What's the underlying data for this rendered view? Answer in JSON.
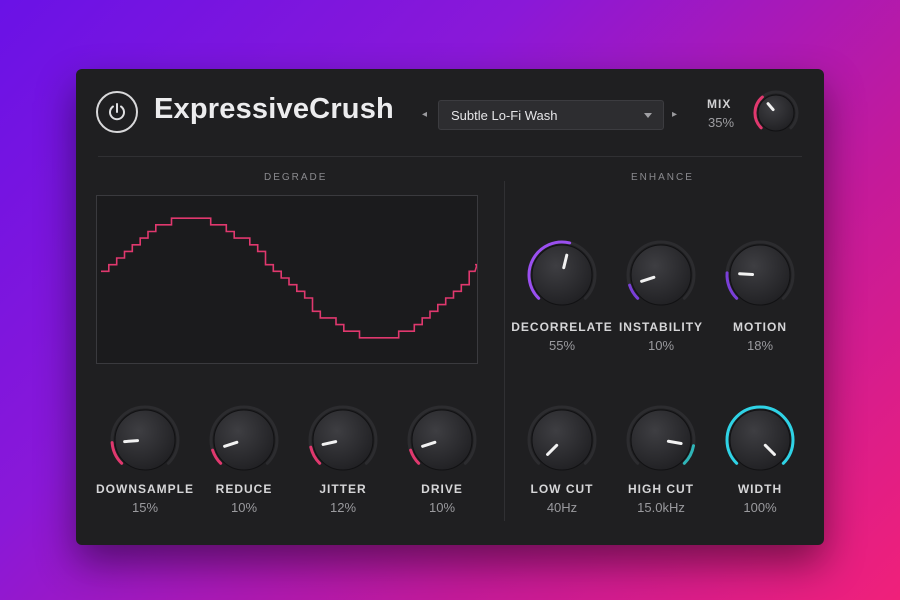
{
  "header": {
    "title": "ExpressiveCrush",
    "preset": "Subtle Lo-Fi Wash",
    "prev_glyph": "◂",
    "next_glyph": "▸",
    "caret_glyph": "▾",
    "mix_label": "MIX",
    "mix_value": "35%",
    "mix_level": 0.35
  },
  "sections": {
    "degrade": "DEGRADE",
    "enhance": "ENHANCE"
  },
  "knobs": {
    "downsample": {
      "label": "DOWNSAMPLE",
      "value": "15%",
      "level": 0.15
    },
    "reduce": {
      "label": "REDUCE",
      "value": "10%",
      "level": 0.1
    },
    "jitter": {
      "label": "JITTER",
      "value": "12%",
      "level": 0.12
    },
    "drive": {
      "label": "DRIVE",
      "value": "10%",
      "level": 0.1
    },
    "decorrelate": {
      "label": "DECORRELATE",
      "value": "55%",
      "level": 0.55
    },
    "instability": {
      "label": "INSTABILITY",
      "value": "10%",
      "level": 0.1
    },
    "motion": {
      "label": "MOTION",
      "value": "18%",
      "level": 0.18
    },
    "low_cut": {
      "label": "LOW CUT",
      "value": "40Hz",
      "level": 0.0
    },
    "high_cut": {
      "label": "HIGH CUT",
      "value": "15.0kHz",
      "level": 0.87
    },
    "width": {
      "label": "WIDTH",
      "value": "100%",
      "level": 1.0
    }
  },
  "colors": {
    "degrade_accent": "#e0386e",
    "decorrelate_accent": "#9a4ff0",
    "instability_accent": "#7a3fd8",
    "motion_accent": "#7a3fd8",
    "cut_accent": "#2fb5b8",
    "width_accent": "#2fd3e6",
    "mix_accent": "#e0386e",
    "waveform": "#e0386e",
    "track": "#2c2c2f"
  },
  "icons": {
    "power": "power-icon"
  }
}
